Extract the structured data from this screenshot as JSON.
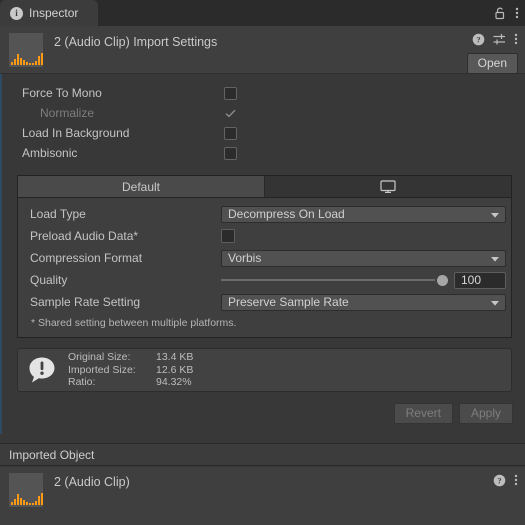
{
  "window": {
    "tab_label": "Inspector",
    "tab_icon": "info-circle-icon",
    "lock_icon": "lock-icon",
    "menu_icon": "kebab-menu-icon"
  },
  "header": {
    "title": "2 (Audio Clip) Import Settings",
    "thumbnail_icon": "audio-waveform-thumbnail",
    "help_icon": "help-circle-icon",
    "preset_icon": "preset-sliders-icon",
    "menu_icon": "kebab-menu-icon",
    "open_button": "Open"
  },
  "properties": [
    {
      "label": "Force To Mono",
      "type": "checkbox",
      "checked": false,
      "disabled": false
    },
    {
      "label": "Normalize",
      "type": "checkbox",
      "checked": true,
      "disabled": true
    },
    {
      "label": "Load In Background",
      "type": "checkbox",
      "checked": false,
      "disabled": false
    },
    {
      "label": "Ambisonic",
      "type": "checkbox",
      "checked": false,
      "disabled": false
    }
  ],
  "platform": {
    "tabs": [
      {
        "label": "Default",
        "active": true,
        "icon": ""
      },
      {
        "label": "",
        "active": false,
        "icon": "monitor-icon"
      }
    ],
    "fields": {
      "load_type_label": "Load Type",
      "load_type_value": "Decompress On Load",
      "preload_label": "Preload Audio Data*",
      "preload_checked": false,
      "compression_label": "Compression Format",
      "compression_value": "Vorbis",
      "quality_label": "Quality",
      "quality_value": "100",
      "quality_percent": 100,
      "sample_rate_label": "Sample Rate Setting",
      "sample_rate_value": "Preserve Sample Rate"
    },
    "note": "* Shared setting between multiple platforms."
  },
  "info": {
    "icon": "warning-bubble-icon",
    "rows": [
      {
        "label": "Original Size:",
        "value": "13.4 KB"
      },
      {
        "label": "Imported Size:",
        "value": "12.6 KB"
      },
      {
        "label": "Ratio:",
        "value": "94.32%"
      }
    ]
  },
  "actions": {
    "revert": "Revert",
    "apply": "Apply"
  },
  "footer": {
    "section_title": "Imported Object",
    "object_title": "2 (Audio Clip)",
    "thumbnail_icon": "audio-waveform-thumbnail",
    "help_icon": "help-circle-icon",
    "menu_icon": "kebab-menu-icon"
  },
  "colors": {
    "background": "#383838",
    "panel": "#3f3f3f",
    "accent": "#2f4b63",
    "waveform": "#ff9a12"
  }
}
